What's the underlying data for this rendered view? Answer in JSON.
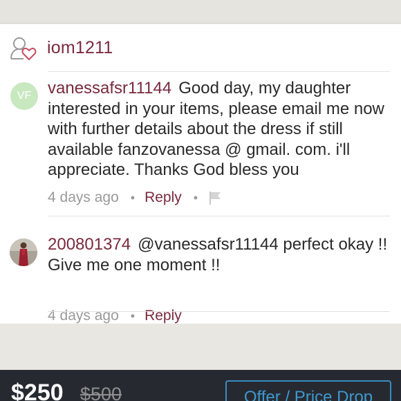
{
  "header": {
    "owner_username": "iom1211",
    "owner_icon": "user-heart-icon"
  },
  "comments": [
    {
      "avatar_initials": "VF",
      "avatar_color": "#c8e8c0",
      "username": "vanessafsr11144",
      "text": "Good day, my daughter interested in your items, please email me now with further details about the dress if still available fanzovanessa @ gmail. com. i'll appreciate. Thanks God bless you",
      "time": "4 days ago",
      "reply_label": "Reply",
      "has_flag": true
    },
    {
      "avatar_type": "photo",
      "username": "200801374",
      "text": "@vanessafsr11144 perfect okay !! Give me one moment !!",
      "time": "4 days ago",
      "reply_label": "Reply",
      "has_flag": false
    }
  ],
  "bottom_bar": {
    "price": "$250",
    "original_price": "$500",
    "offer_button_label": "Offer / Price Drop"
  },
  "colors": {
    "brand_maroon": "#7a2a3e",
    "offer_blue": "#3e98d0",
    "bar_dark": "#262a30"
  }
}
